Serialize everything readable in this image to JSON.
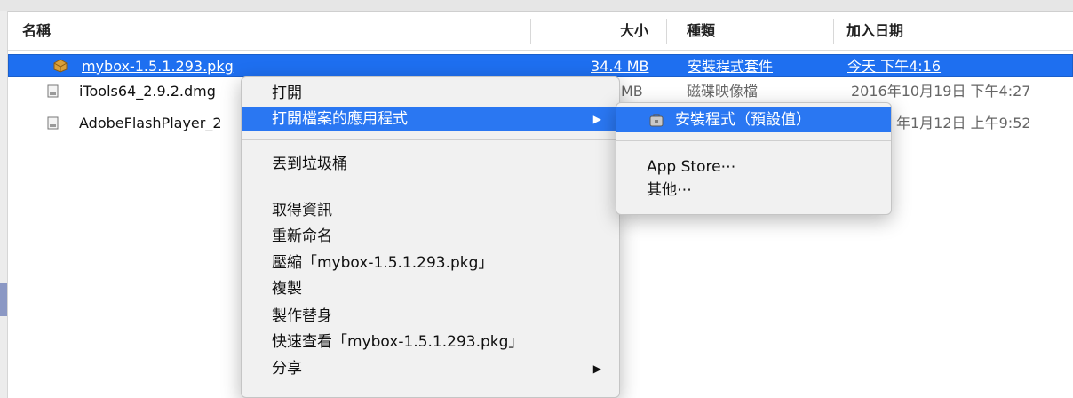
{
  "columns": {
    "name": "名稱",
    "size": "大小",
    "kind": "種類",
    "date_added": "加入日期"
  },
  "files": [
    {
      "name": "mybox-1.5.1.293.pkg",
      "size": "34.4 MB",
      "kind": "安裝程式套件",
      "date": "今天 下午4:16",
      "icon": "package-icon"
    },
    {
      "name": "iTools64_2.9.2.dmg",
      "size": "MB",
      "kind": "磁碟映像檔",
      "date": "2016年10月19日 下午4:27",
      "icon": "disk-image-icon"
    },
    {
      "name": "AdobeFlashPlayer_2",
      "size": "",
      "kind": "",
      "date": "年1月12日 上午9:52",
      "icon": "disk-image-icon"
    }
  ],
  "context_menu": {
    "open": "打開",
    "open_with": "打開檔案的應用程式",
    "trash": "丟到垃圾桶",
    "get_info": "取得資訊",
    "rename": "重新命名",
    "compress": "壓縮「mybox-1.5.1.293.pkg」",
    "duplicate": "複製",
    "make_alias": "製作替身",
    "quick_look": "快速查看「mybox-1.5.1.293.pkg」",
    "share": "分享"
  },
  "open_with_submenu": {
    "installer_default": "安裝程式（預設值）",
    "app_store": "App Store⋯",
    "other": "其他⋯"
  },
  "colors": {
    "selection": "#1e6ff0",
    "menu_highlight": "#2a77f2"
  }
}
